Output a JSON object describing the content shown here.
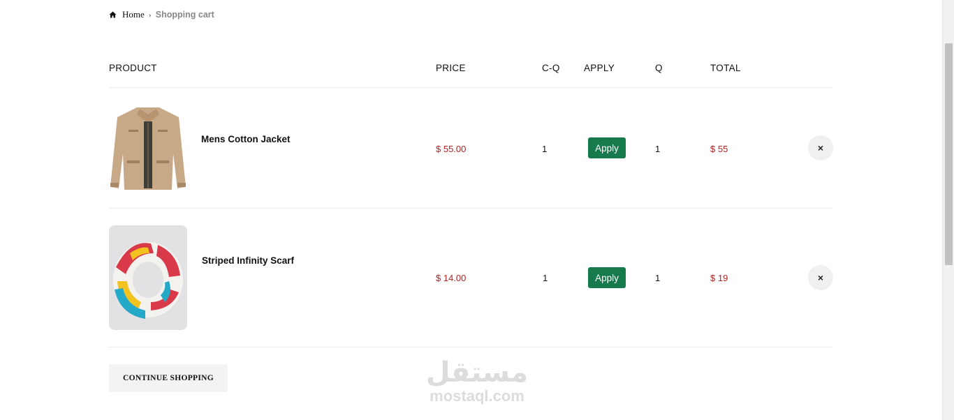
{
  "breadcrumb": {
    "home": "Home",
    "separator": "›",
    "current": "Shopping cart"
  },
  "table": {
    "headers": {
      "product": "PRODUCT",
      "price": "PRICE",
      "cq": "C-Q",
      "apply": "APPLY",
      "q": "Q",
      "total": "TOTAL"
    },
    "rows": [
      {
        "name": "Mens Cotton Jacket",
        "price": "$ 55.00",
        "cq": "1",
        "apply_label": "Apply",
        "q": "1",
        "total": "$ 55",
        "remove_label": "×"
      },
      {
        "name": "Striped Infinity Scarf",
        "price": "$ 14.00",
        "cq": "1",
        "apply_label": "Apply",
        "q": "1",
        "total": "$ 19",
        "remove_label": "×"
      }
    ]
  },
  "continue_label": "CONTINUE SHOPPING",
  "watermark": {
    "arabic": "مستقل",
    "latin": "mostaql.com"
  },
  "colors": {
    "price": "#b12323",
    "apply_button": "#177a4c",
    "remove_button": "#f0f0f0"
  }
}
